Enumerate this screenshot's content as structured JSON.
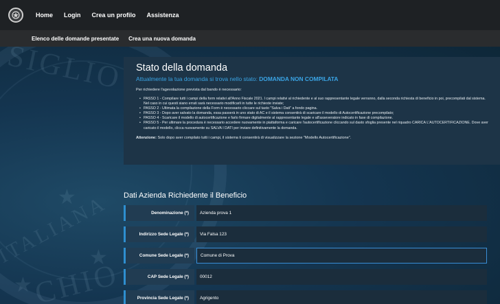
{
  "nav": {
    "links": [
      "Home",
      "Login",
      "Crea un profilo",
      "Assistenza"
    ]
  },
  "subnav": {
    "links": [
      "Elenco delle domande presentate",
      "Crea una nuova domanda"
    ]
  },
  "watermark": {
    "top_text": "SIGLIO",
    "bottom_text": "CHIO",
    "side_text": "ITALIANA"
  },
  "status": {
    "title": "Stato della domanda",
    "prefix": "Attualmente la tua domanda si trova nello stato: ",
    "state": "DOMANDA NON COMPILATA",
    "intro": "Per richiedere l'agevolazione prevista dal bando è necessario:",
    "steps": [
      "PASSO 1 - Compilare tutti i campi della form relativi all'Anno Fiscale 2021. I campi relativi al richiedente e al suo rappresentante legale verranno, dalla seconda richiesta di beneficio in poi, precompilati dal sistema. Nel caso in cui questi siano errati sarà necessario modificarli in tutte le richieste inviate;",
      "PASSO 2 - Ultimata la compilazione della Form è necessario cliccare sul tasto \"Salva i Dati\" a fondo pagina.",
      "PASSO 3 - Dopo aver salvato la domanda, essa passerà in uno stato di AC e il sistema consentirà di scaricare il modello di Autocertificazione precompilato;",
      "PASSO 4 - Scaricare il modello di autocertificazione e farlo firmare digitalmente al rappresentante legale e all'asseveratore indicato in fase di compilazione.",
      "PASSO 5 - Per ultimare la procedura è necessario accedere nuovamente in piattaforma e caricare l'autocertificazione cliccando sul dasto sfoglia presente nel riquadro CARICA L'AUTOCERTIFICAZIONE. Dove aver caricato il modello, clicca nuovamente su SALVA I DATI per inviare definitivamente la domanda."
    ],
    "attention_label": "Attenzione:",
    "attention_text": " Solo dopo aver compilato tutti i campi, il sistema ti consentirà di visualizzare la sezione \"Modello Autocertificazione\"."
  },
  "form": {
    "section_title": "Dati Azienda Richiedente il Beneficio",
    "fields": [
      {
        "label": "Denominazione (*)",
        "value": "Azienda prova 1"
      },
      {
        "label": "Indirizzo Sede Legale (*)",
        "value": "Via Falsa 123"
      },
      {
        "label": "Comune Sede Legale (*)",
        "value": "Comune di Prova"
      },
      {
        "label": "CAP Sede Legale (*)",
        "value": "00012"
      },
      {
        "label": "Provincia Sede Legale (*)",
        "value": "Agrigento"
      }
    ]
  },
  "colors": {
    "accent": "#3aa5e6",
    "navbar": "#1e2124",
    "panel": "#1d3447"
  }
}
